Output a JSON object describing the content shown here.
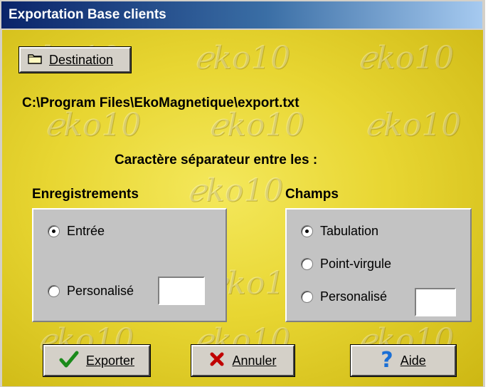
{
  "window": {
    "title": "Exportation Base clients"
  },
  "destination": {
    "button_label": "Destination",
    "path": "C:\\Program Files\\EkoMagnetique\\export.txt"
  },
  "separator_heading": "Caractère séparateur entre les :",
  "records": {
    "label": "Enregistrements",
    "options": [
      {
        "label": "Entrée",
        "selected": true
      },
      {
        "label": "Personalisé",
        "selected": false
      }
    ],
    "custom_value": ""
  },
  "fields": {
    "label": "Champs",
    "options": [
      {
        "label": "Tabulation",
        "selected": true
      },
      {
        "label": "Point-virgule",
        "selected": false
      },
      {
        "label": "Personalisé",
        "selected": false
      }
    ],
    "custom_value": ""
  },
  "actions": {
    "export_label": "Exporter",
    "cancel_label": "Annuler",
    "help_label": "Aide"
  },
  "icons": {
    "destination": "folder-icon",
    "export": "checkmark-icon",
    "cancel": "cross-icon",
    "help": "question-mark-icon"
  },
  "colors": {
    "title_bar": "#0a246a",
    "background": "#e8d632",
    "check": "#1a8a1a",
    "cross": "#c00000",
    "help": "#1a6fd6"
  }
}
